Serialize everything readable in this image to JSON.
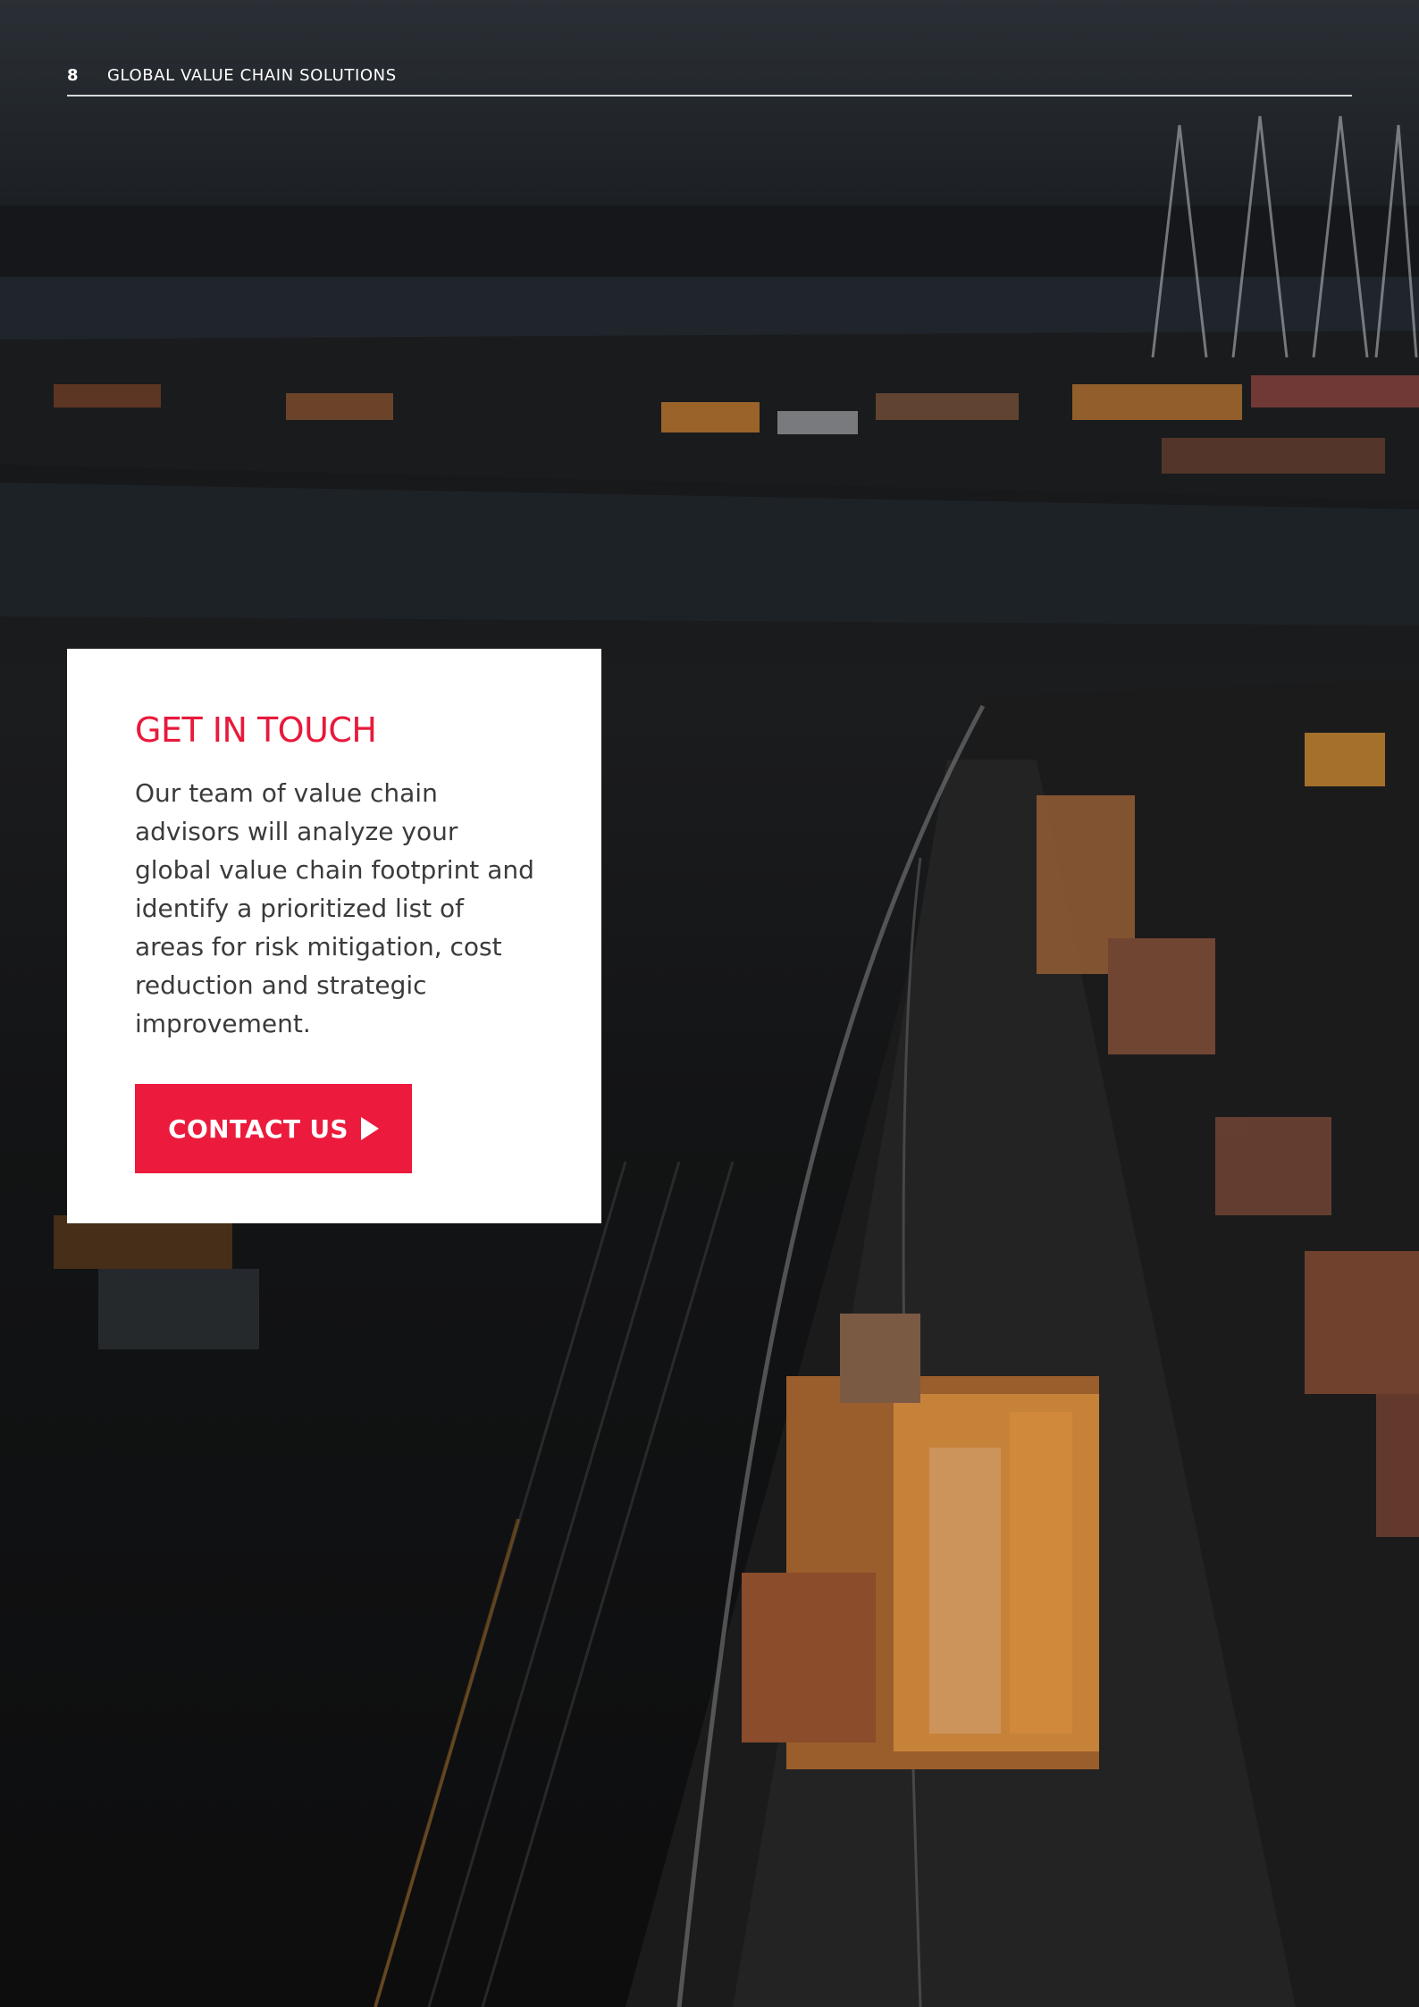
{
  "header": {
    "page_number": "8",
    "title": "GLOBAL VALUE CHAIN SOLUTIONS"
  },
  "card": {
    "heading": "GET IN TOUCH",
    "body": "Our team of value chain advisors will analyze your global value chain footprint and identify a prioritized list of areas for risk mitigation, cost reduction and strategic improvement.",
    "button_label": "CONTACT US",
    "button_icon": "play-arrow-icon"
  },
  "background": {
    "description_icon": "port-photo",
    "text": "NEWLINE"
  },
  "colors": {
    "accent": "#ec1a3c",
    "heading": "#e8193b",
    "body_text": "#3b3b3d",
    "card_bg": "#ffffff"
  }
}
